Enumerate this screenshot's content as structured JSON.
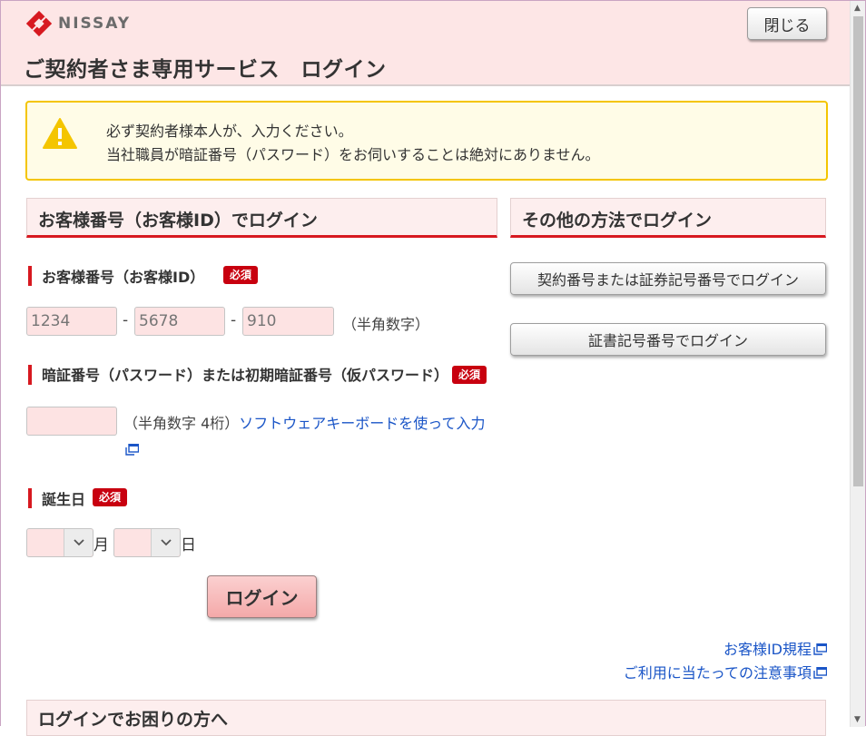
{
  "header": {
    "brand": "NISSAY",
    "close_label": "閉じる",
    "page_title": "ご契約者さま専用サービス　ログイン"
  },
  "notice": {
    "line1": "必ず契約者様本人が、入力ください。",
    "line2": "当社職員が暗証番号（パスワード）をお伺いすることは絶対にありません。"
  },
  "login_section": {
    "heading": "お客様番号（お客様ID）でログイン",
    "customer_number": {
      "label": "お客様番号（お客様ID）",
      "required": "必須",
      "part1_placeholder": "1234",
      "part2_placeholder": "5678",
      "part3_placeholder": "910",
      "separator": "-",
      "hint": "（半角数字）"
    },
    "pin": {
      "label": "暗証番号（パスワード）または初期暗証番号（仮パスワード）",
      "required": "必須",
      "hint": "（半角数字 4桁）",
      "keyboard_link": "ソフトウェアキーボードを使って入力"
    },
    "birthday": {
      "label": "誕生日",
      "required": "必須",
      "month_unit": "月",
      "day_unit": "日"
    },
    "login_button": "ログイン"
  },
  "other_section": {
    "heading": "その他の方法でログイン",
    "button1": "契約番号または証券記号番号でログイン",
    "button2": "証書記号番号でログイン"
  },
  "footer_links": {
    "terms": "お客様ID規程",
    "notes": "ご利用に当たっての注意事項"
  },
  "trouble_heading": "ログインでお困りの方へ",
  "colors": {
    "accent_red": "#d71920",
    "header_bg": "#fde6e6",
    "input_bg": "#fde3e3",
    "notice_border": "#f4c500",
    "link": "#1a55c7"
  },
  "icons": [
    "nissay-logo",
    "warning-icon",
    "external-window-icon",
    "chevron-down-icon"
  ]
}
